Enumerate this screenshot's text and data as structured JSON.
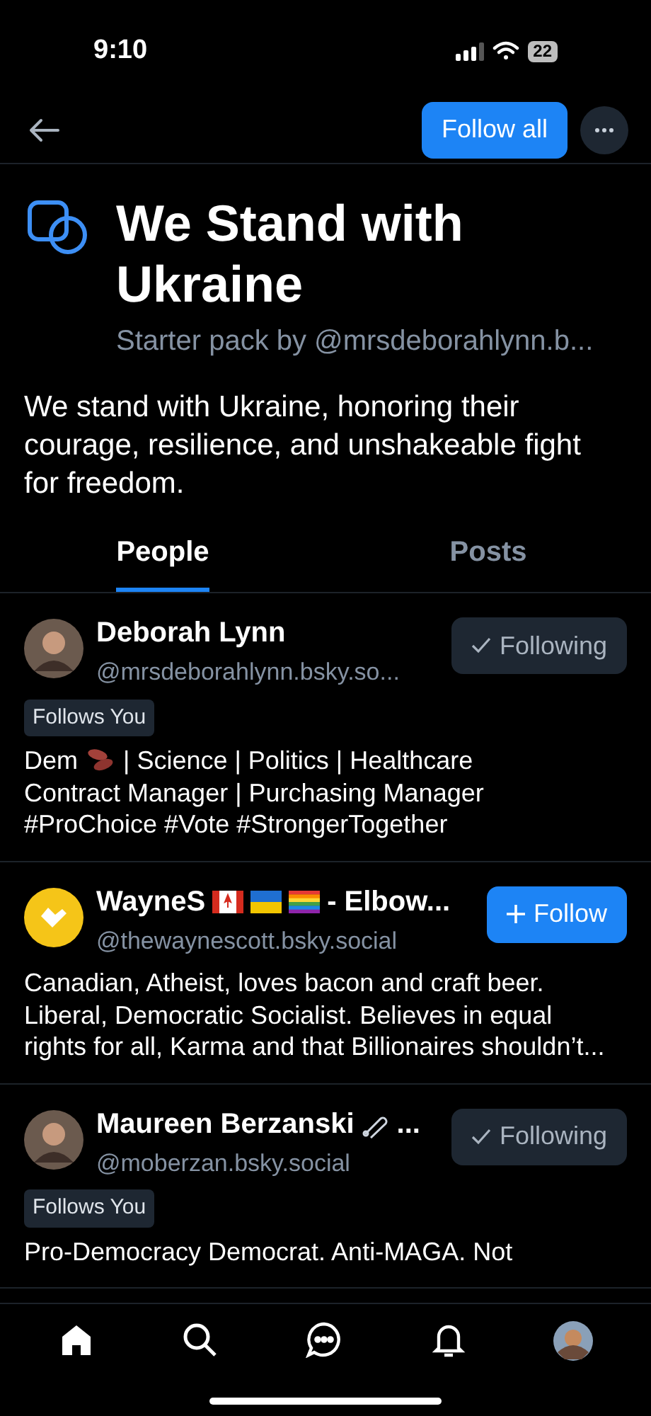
{
  "status_bar": {
    "time": "9:10",
    "battery": "22"
  },
  "header": {
    "follow_all": "Follow all"
  },
  "pack": {
    "title": "We Stand with Ukraine",
    "byline": "Starter pack by @mrsdeborahlynn.b...",
    "description": "We stand with Ukraine, honoring their courage, resilience, and unshakeable fight for freedom."
  },
  "tabs": [
    {
      "label": "People",
      "selected": true
    },
    {
      "label": "Posts",
      "selected": false
    }
  ],
  "people": [
    {
      "avatar": {
        "kind": "photo"
      },
      "name": "Deborah Lynn",
      "handle": "@mrsdeborahlynn.bsky.so...",
      "following": true,
      "button": "Following",
      "follows_you": "Follows You",
      "bio_first_line": [
        {
          "kind": "text",
          "text": "Dem"
        },
        {
          "kind": "beans"
        },
        {
          "kind": "text",
          "text": "| Science | Politics | Healthcare"
        }
      ],
      "bio": "Contract Manager | Purchasing Manager #ProChoice #Vote #StrongerTogether"
    },
    {
      "avatar": {
        "kind": "logo"
      },
      "name": "WayneS",
      "badges": [
        {
          "kind": "canada"
        },
        {
          "kind": "ukraine"
        },
        {
          "kind": "rainbow"
        }
      ],
      "name_tail": "- Elbow...",
      "handle": "@thewaynescott.bsky.social",
      "following": false,
      "button": "Follow",
      "bio": "Canadian, Atheist, loves bacon and craft beer. Liberal, Democratic Socialist. Believes in equal rights for all, Karma and that Billionaires shouldn’t..."
    },
    {
      "avatar": {
        "kind": "photo"
      },
      "name": "Maureen Berzanski",
      "badges": [
        {
          "kind": "pin"
        }
      ],
      "name_tail": "...",
      "handle": "@moberzan.bsky.social",
      "following": true,
      "button": "Following",
      "follows_you": "Follows You",
      "bio": "Pro-Democracy Democrat. Anti-MAGA. Not"
    }
  ]
}
